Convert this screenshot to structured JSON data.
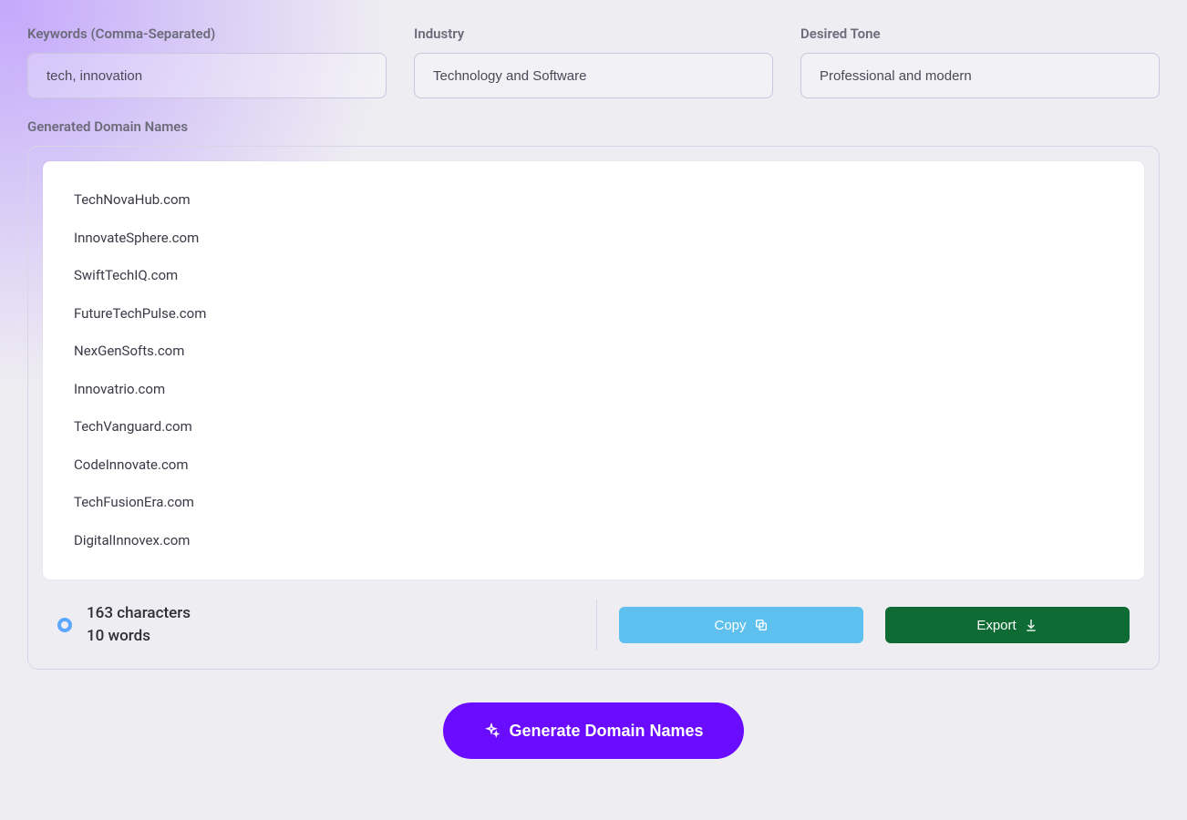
{
  "form": {
    "keywords": {
      "label": "Keywords (Comma-Separated)",
      "value": "tech, innovation"
    },
    "industry": {
      "label": "Industry",
      "value": "Technology and Software"
    },
    "tone": {
      "label": "Desired Tone",
      "value": "Professional and modern"
    }
  },
  "results": {
    "label": "Generated Domain Names",
    "items": [
      "TechNovaHub.com",
      "InnovateSphere.com",
      "SwiftTechIQ.com",
      "FutureTechPulse.com",
      "NexGenSofts.com",
      "Innovatrio.com",
      "TechVanguard.com",
      "CodeInnovate.com",
      "TechFusionEra.com",
      "DigitalInnovex.com"
    ],
    "stats": {
      "characters_line": "163 characters",
      "words_line": "10 words"
    }
  },
  "actions": {
    "copy": "Copy",
    "export": "Export",
    "generate": "Generate Domain Names"
  },
  "colors": {
    "accent_violet": "#6a0cff",
    "copy_blue": "#5ec0ee",
    "export_green": "#0f6b34",
    "ring_blue": "#5aa8ff"
  }
}
